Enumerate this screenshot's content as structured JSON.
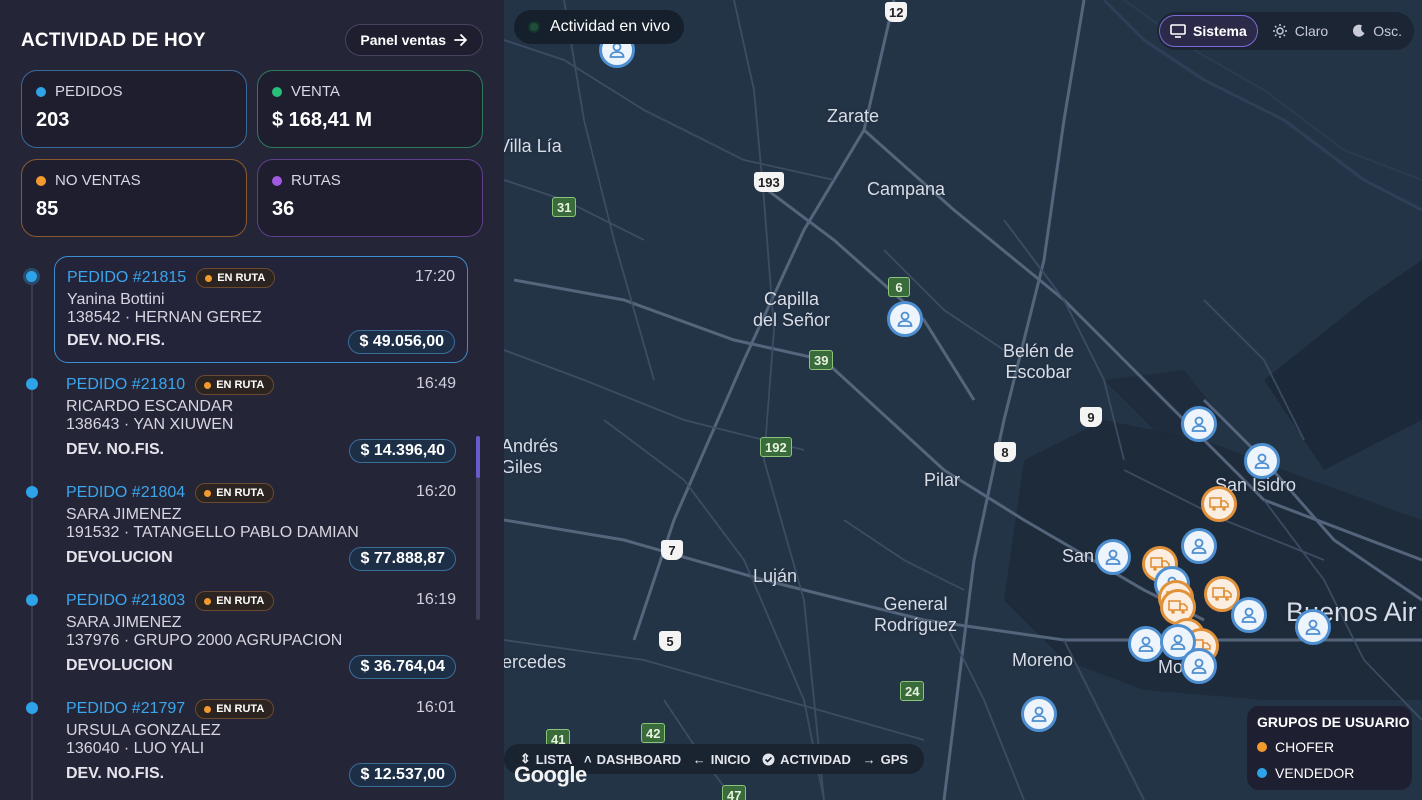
{
  "panel": {
    "title": "ACTIVIDAD DE HOY",
    "sales_button": "Panel ventas",
    "stats": [
      {
        "label": "PEDIDOS",
        "value": "203",
        "color": "#2ea3e8",
        "border": "#3a6a9a"
      },
      {
        "label": "VENTA",
        "value": "$ 168,41 M",
        "color": "#27c07a",
        "border": "#2f7a5c"
      },
      {
        "label": "NO VENTAS",
        "value": "85",
        "color": "#f39a2e",
        "border": "#8a5a2e"
      },
      {
        "label": "RUTAS",
        "value": "36",
        "color": "#a05ae0",
        "border": "#5e3f8a"
      }
    ],
    "orders": [
      {
        "id": "PEDIDO #21815",
        "status": "EN RUTA",
        "time": "17:20",
        "customer": "Yanina Bottini",
        "seller": "138542 · HERNAN GEREZ",
        "type": "DEV. NO.FIS.",
        "amount": "$ 49.056,00"
      },
      {
        "id": "PEDIDO #21810",
        "status": "EN RUTA",
        "time": "16:49",
        "customer": "RICARDO ESCANDAR",
        "seller": "138643 · YAN XIUWEN",
        "type": "DEV. NO.FIS.",
        "amount": "$ 14.396,40"
      },
      {
        "id": "PEDIDO #21804",
        "status": "EN RUTA",
        "time": "16:20",
        "customer": "SARA JIMENEZ",
        "seller": "191532 · TATANGELLO PABLO DAMIAN",
        "type": "DEVOLUCION",
        "amount": "$ 77.888,87"
      },
      {
        "id": "PEDIDO #21803",
        "status": "EN RUTA",
        "time": "16:19",
        "customer": "SARA JIMENEZ",
        "seller": "137976 · GRUPO 2000 AGRUPACION",
        "type": "DEVOLUCION",
        "amount": "$ 36.764,04"
      },
      {
        "id": "PEDIDO #21797",
        "status": "EN RUTA",
        "time": "16:01",
        "customer": "URSULA GONZALEZ",
        "seller": "136040 · LUO YALI",
        "type": "DEV. NO.FIS.",
        "amount": "$ 12.537,00"
      }
    ]
  },
  "map": {
    "live_label": "Actividad en vivo",
    "theme": {
      "system": "Sistema",
      "light": "Claro",
      "dark": "Osc."
    },
    "cities": [
      "Zarate",
      "Villa Lía",
      "Campana",
      "Capilla del Señor",
      "Belén de Escobar",
      "San Andrés de Giles",
      "Pilar",
      "San Isidro",
      "San Miguel",
      "Luján",
      "General Rodríguez",
      "Moreno",
      "Mercedes",
      "Buenos Aires",
      "Morón"
    ],
    "city_lines": {
      "zarate": "Zarate",
      "villa_lia": "Villa Lía",
      "campana": "Campana",
      "capilla_1": "Capilla",
      "capilla_2": "del Señor",
      "belen_1": "Belén de",
      "belen_2": "Escobar",
      "andres_1": "Andrés",
      "andres_2": "Giles",
      "pilar": "Pilar",
      "san_isidro": "San Isidro",
      "san_miguel": "San",
      "lujan": "Luján",
      "general_1": "General",
      "general_2": "Rodríguez",
      "moreno": "Moreno",
      "mercedes": "ercedes",
      "buenos_aires": "Buenos Air",
      "moron": "Mo"
    },
    "routes": {
      "r12": "12",
      "r193": "193",
      "r31": "31",
      "r6": "6",
      "r39": "39",
      "r9": "9",
      "r192": "192",
      "r8": "8",
      "r7": "7",
      "r5": "5",
      "r24": "24",
      "r42": "42",
      "r41": "41",
      "r47": "47"
    },
    "nav": {
      "list": "LISTA",
      "dashboard": "DASHBOARD",
      "home": "INICIO",
      "activity": "ACTIVIDAD",
      "gps": "GPS"
    },
    "legend": {
      "title": "GRUPOS DE USUARIO",
      "driver": "CHOFER",
      "seller": "VENDEDOR",
      "driver_color": "#f39a2e",
      "seller_color": "#2ea3e8"
    },
    "attribution": "Google"
  }
}
